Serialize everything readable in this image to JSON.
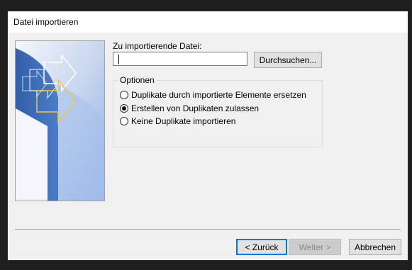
{
  "window": {
    "title": "Datei importieren"
  },
  "file": {
    "label": "Zu importierende Datei:",
    "value": "",
    "browse_label": "Durchsuchen..."
  },
  "options": {
    "legend": "Optionen",
    "items": [
      {
        "label": "Duplikate durch importierte Elemente ersetzen",
        "checked": false
      },
      {
        "label": "Erstellen von Duplikaten zulassen",
        "checked": true
      },
      {
        "label": "Keine Duplikate importieren",
        "checked": false
      }
    ]
  },
  "buttons": {
    "back": "< Zurück",
    "next": "Weiter >",
    "cancel": "Abbrechen"
  },
  "colors": {
    "accent": "#0078d7",
    "art_blue": "#2e5aa8",
    "arrow_yellow": "#e8c84a"
  },
  "art": {
    "icon": "import-wizard-arrows-art"
  }
}
